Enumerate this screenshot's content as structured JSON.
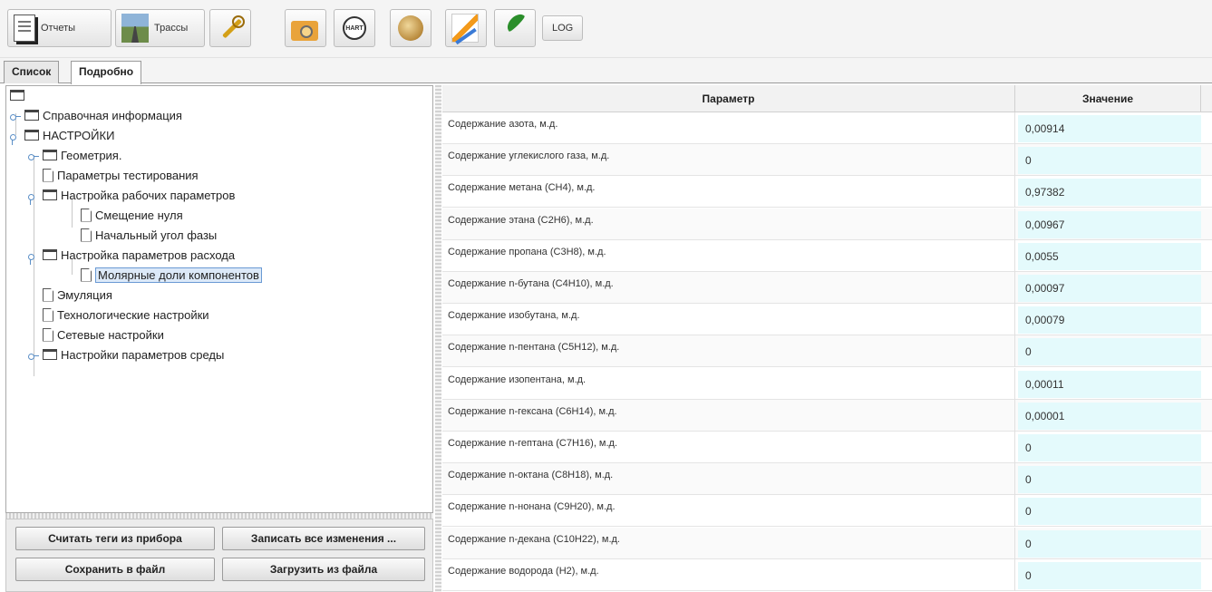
{
  "toolbar": {
    "reports_label": "Отчеты",
    "routes_label": "Трассы",
    "hart_icon_text": "HART",
    "log_label": "LOG"
  },
  "tabs": [
    {
      "label": "Список",
      "active": false
    },
    {
      "label": "Подробно",
      "active": true
    }
  ],
  "tree": {
    "items": [
      {
        "label": "Справочная информация",
        "type": "folder"
      },
      {
        "label": "НАСТРОЙКИ",
        "type": "folder"
      },
      {
        "label": "Геометрия.",
        "type": "folder"
      },
      {
        "label": "Параметры тестирования",
        "type": "file"
      },
      {
        "label": "Настройка рабочих параметров",
        "type": "folder"
      },
      {
        "label": "Смещение нуля",
        "type": "file"
      },
      {
        "label": "Начальный угол фазы",
        "type": "file"
      },
      {
        "label": "Настройка параметров расхода",
        "type": "folder"
      },
      {
        "label": "Молярные доли компонентов",
        "type": "file",
        "selected": true
      },
      {
        "label": "Эмуляция",
        "type": "file"
      },
      {
        "label": "Технологические настройки",
        "type": "file"
      },
      {
        "label": "Сетевые настройки",
        "type": "file"
      },
      {
        "label": "Настройки параметров среды",
        "type": "folder"
      }
    ]
  },
  "actions": {
    "read_tags": "Считать теги из прибора",
    "write_all": "Записать все изменения ...",
    "save_file": "Сохранить в файл",
    "load_file": "Загрузить из файла"
  },
  "table": {
    "col_param": "Параметр",
    "col_value": "Значение",
    "rows": [
      {
        "name": "Содержание азота, м.д.",
        "value": "0,00914"
      },
      {
        "name": "Содержание углекислого газа, м.д.",
        "value": "0"
      },
      {
        "name": "Содержание метана (CH4), м.д.",
        "value": "0,97382"
      },
      {
        "name": "Содержание этана (C2H6), м.д.",
        "value": "0,00967"
      },
      {
        "name": "Содержание пропана (C3H8), м.д.",
        "value": "0,0055"
      },
      {
        "name": "Содержание n-бутана (C4H10), м.д.",
        "value": "0,00097"
      },
      {
        "name": "Содержание изобутана, м.д.",
        "value": "0,00079"
      },
      {
        "name": "Содержание n-пентана (C5H12), м.д.",
        "value": "0"
      },
      {
        "name": "Содержание изопентана, м.д.",
        "value": "0,00011"
      },
      {
        "name": "Содержание n-гексана (C6H14), м.д.",
        "value": "0,00001"
      },
      {
        "name": "Содержание n-гептана (C7H16), м.д.",
        "value": "0"
      },
      {
        "name": "Содержание n-октана (C8H18), м.д.",
        "value": "0"
      },
      {
        "name": "Содержание n-нонана (C9H20), м.д.",
        "value": "0"
      },
      {
        "name": "Содержание n-декана (C10H22), м.д.",
        "value": "0"
      },
      {
        "name": "Содержание водорода (H2), м.д.",
        "value": "0"
      }
    ]
  },
  "colors": {
    "value_cell_bg": "#e4fafc",
    "selection_border": "#6a9ad4",
    "tree_connector": "#5b8fc7"
  }
}
